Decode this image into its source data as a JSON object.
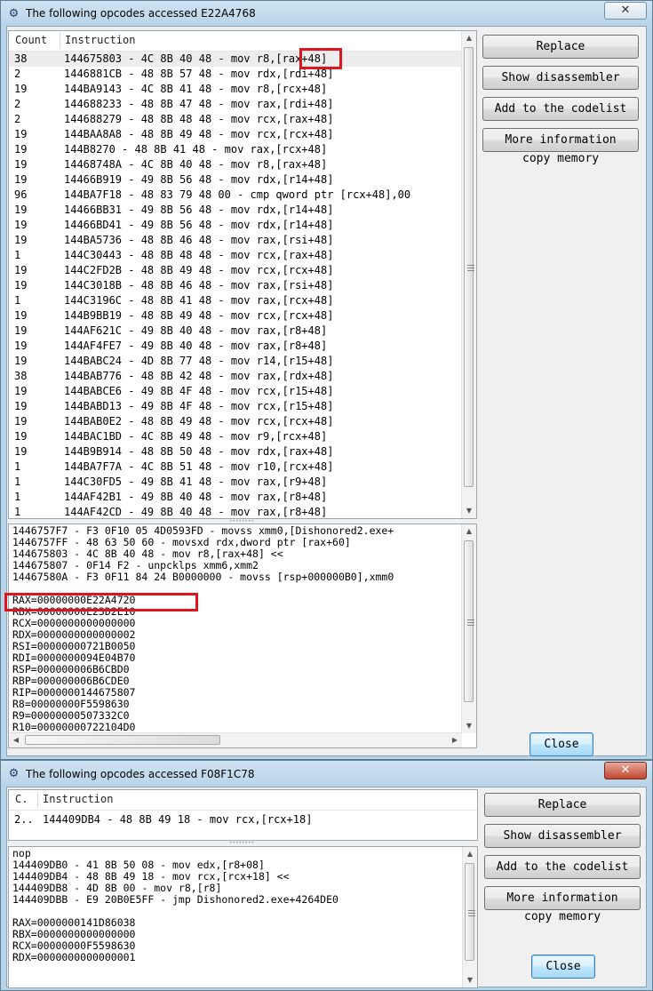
{
  "window1": {
    "title": "The following opcodes accessed E22A4768",
    "close_glyph": "✕",
    "columns": [
      "Count",
      "Instruction"
    ],
    "rows": [
      {
        "count": "38",
        "instruction": "144675803 - 4C 8B 40 48  - mov r8,[rax+48]"
      },
      {
        "count": "2",
        "instruction": "1446881CB - 48 8B 57 48  - mov rdx,[rdi+48]"
      },
      {
        "count": "19",
        "instruction": "144BA9143 - 4C 8B 41 48  - mov r8,[rcx+48]"
      },
      {
        "count": "2",
        "instruction": "144688233 - 48 8B 47 48  - mov rax,[rdi+48]"
      },
      {
        "count": "2",
        "instruction": "144688279 - 48 8B 48 48  - mov rcx,[rax+48]"
      },
      {
        "count": "19",
        "instruction": "144BAA8A8 - 48 8B 49 48  - mov rcx,[rcx+48]"
      },
      {
        "count": "19",
        "instruction": "144B8270 - 48 8B 41 48  - mov rax,[rcx+48]"
      },
      {
        "count": "19",
        "instruction": "14468748A - 4C 8B 40 48  - mov r8,[rax+48]"
      },
      {
        "count": "19",
        "instruction": "14466B919 - 49 8B 56 48  - mov rdx,[r14+48]"
      },
      {
        "count": "96",
        "instruction": "144BA7F18 - 48 83 79 48 00 - cmp qword ptr [rcx+48],00"
      },
      {
        "count": "19",
        "instruction": "14466BB31 - 49 8B 56 48  - mov rdx,[r14+48]"
      },
      {
        "count": "19",
        "instruction": "14466BD41 - 49 8B 56 48  - mov rdx,[r14+48]"
      },
      {
        "count": "19",
        "instruction": "144BA5736 - 48 8B 46 48  - mov rax,[rsi+48]"
      },
      {
        "count": "1",
        "instruction": "144C30443 - 48 8B 48 48  - mov rcx,[rax+48]"
      },
      {
        "count": "19",
        "instruction": "144C2FD2B - 48 8B 49 48  - mov rcx,[rcx+48]"
      },
      {
        "count": "19",
        "instruction": "144C3018B - 48 8B 46 48  - mov rax,[rsi+48]"
      },
      {
        "count": "1",
        "instruction": "144C3196C - 48 8B 41 48  - mov rax,[rcx+48]"
      },
      {
        "count": "19",
        "instruction": "144B9BB19 - 48 8B 49 48  - mov rcx,[rcx+48]"
      },
      {
        "count": "19",
        "instruction": "144AF621C - 49 8B 40 48  - mov rax,[r8+48]"
      },
      {
        "count": "19",
        "instruction": "144AF4FE7 - 49 8B 40 48  - mov rax,[r8+48]"
      },
      {
        "count": "19",
        "instruction": "144BABC24 - 4D 8B 77 48  - mov r14,[r15+48]"
      },
      {
        "count": "38",
        "instruction": "144BAB776 - 48 8B 42 48  - mov rax,[rdx+48]"
      },
      {
        "count": "19",
        "instruction": "144BABCE6 - 49 8B 4F 48  - mov rcx,[r15+48]"
      },
      {
        "count": "19",
        "instruction": "144BABD13 - 49 8B 4F 48  - mov rcx,[r15+48]"
      },
      {
        "count": "19",
        "instruction": "144BAB0E2 - 48 8B 49 48  - mov rcx,[rcx+48]"
      },
      {
        "count": "19",
        "instruction": "144BAC1BD - 4C 8B 49 48  - mov r9,[rcx+48]"
      },
      {
        "count": "19",
        "instruction": "144B9B914 - 48 8B 50 48  - mov rdx,[rax+48]"
      },
      {
        "count": "1",
        "instruction": "144BA7F7A - 4C 8B 51 48  - mov r10,[rcx+48]"
      },
      {
        "count": "1",
        "instruction": "144C30FD5 - 49 8B 41 48  - mov rax,[r9+48]"
      },
      {
        "count": "1",
        "instruction": "144AF42B1 - 49 8B 40 48  - mov rax,[r8+48]"
      },
      {
        "count": "1",
        "instruction": "144AF42CD - 49 8B 40 48  - mov rax,[r8+48]"
      }
    ],
    "details": [
      "1446757F7 - F3 0F10 05 4D0593FD  - movss xmm0,[Dishonored2.exe+",
      "1446757FF - 48 63 50 60  - movsxd  rdx,dword ptr [rax+60]",
      "144675803 - 4C 8B 40 48  - mov r8,[rax+48] <<",
      "144675807 - 0F14 F2  - unpcklps xmm6,xmm2",
      "14467580A - F3 0F11 84 24 B0000000  - movss [rsp+000000B0],xmm0",
      "",
      "RAX=00000000E22A4720",
      "RBX=00000000E23D2E10",
      "RCX=0000000000000000",
      "RDX=0000000000000002",
      "RSI=00000000721B0050",
      "RDI=0000000094E04B70",
      "RSP=000000006B6CBD0",
      "RBP=000000006B6CDE0",
      "RIP=0000000144675807",
      "R8=00000000F5598630",
      "R9=00000000507332C0",
      "R10=00000000722104D0"
    ],
    "buttons": {
      "replace": "Replace",
      "show_disassembler": "Show disassembler",
      "add_codelist": "Add to the codelist",
      "more_info": "More information",
      "copy_memory": "copy memory",
      "close": "Close"
    }
  },
  "window2": {
    "title": "The following opcodes accessed F08F1C78",
    "close_glyph": "✕",
    "columns": [
      "C.",
      "Instruction"
    ],
    "rows": [
      {
        "count": "2..",
        "instruction": "144409DB4 - 48 8B 49 18  - mov rcx,[rcx+18]"
      }
    ],
    "details": [
      "nop",
      "144409DB0 - 41 8B 50 08  - mov edx,[r8+08]",
      "144409DB4 - 48 8B 49 18  - mov rcx,[rcx+18] <<",
      "144409DB8 - 4D 8B 00  - mov r8,[r8]",
      "144409DBB - E9 20B0E5FF - jmp Dishonored2.exe+4264DE0",
      "",
      "RAX=0000000141D86038",
      "RBX=0000000000000000",
      "RCX=00000000F5598630",
      "RDX=0000000000000001"
    ],
    "buttons": {
      "replace": "Replace",
      "show_disassembler": "Show disassembler",
      "add_codelist": "Add to the codelist",
      "more_info": "More information",
      "copy_memory": "copy memory",
      "close": "Close"
    }
  }
}
